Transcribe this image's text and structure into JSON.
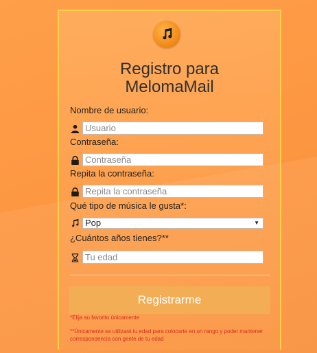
{
  "form": {
    "title": "Registro para\nMelomaMail",
    "username": {
      "label": "Nombre de usuario:",
      "placeholder": "Usuario"
    },
    "password": {
      "label": "Contraseña:",
      "placeholder": "Contraseña"
    },
    "password_repeat": {
      "label": "Repita la contraseña:",
      "placeholder": "Repita la contraseña"
    },
    "music": {
      "label": "Qué tipo de música le gusta*:",
      "selected": "Pop"
    },
    "age": {
      "label": "¿Cuántos años tienes?**",
      "placeholder": "Tu edad"
    },
    "submit_label": "Registrarme",
    "note_1": "*Elija su favorito únicamente",
    "note_2": "**Únicamente se utilizará tu edad para colocarte en un rango y poder mantener correspondencia con gente de tu edad"
  },
  "icons": {
    "logo": "music-note-icon",
    "username": "user-icon",
    "password": "lock-icon",
    "password_repeat": "lock-icon",
    "music": "music-note-icon",
    "age": "hourglass-icon"
  },
  "colors": {
    "background": "#fd9742",
    "card_border": "#ffd24a",
    "button": "#f3ad55",
    "note_text": "#d62c1f"
  }
}
